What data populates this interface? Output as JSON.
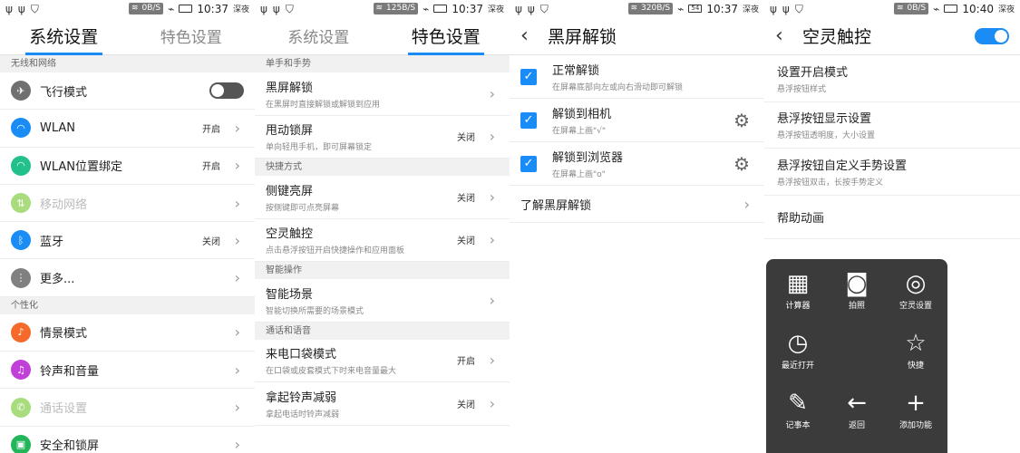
{
  "panels": {
    "p1": {
      "status": {
        "speed": "0B/S",
        "time": "10:37",
        "sub": "深夜"
      },
      "tabs": [
        "系统设置",
        "特色设置"
      ],
      "sections": {
        "wireless": "无线和网络",
        "personal": "个性化"
      },
      "rows": [
        {
          "label": "飞行模式",
          "icon": "airplane-icon",
          "color": "#707070"
        },
        {
          "label": "WLAN",
          "value": "开启",
          "icon": "wifi-icon",
          "color": "#1a8cf5"
        },
        {
          "label": "WLAN位置绑定",
          "value": "开启",
          "icon": "wifi-location-icon",
          "color": "#22c08a"
        },
        {
          "label": "移动网络",
          "icon": "mobile-network-icon",
          "color": "#a8dc7c"
        },
        {
          "label": "蓝牙",
          "value": "关闭",
          "icon": "bluetooth-icon",
          "color": "#1a8cf5"
        },
        {
          "label": "更多...",
          "icon": "more-icon",
          "color": "#808080"
        },
        {
          "label": "情景模式",
          "icon": "bell-icon",
          "color": "#f56a2a"
        },
        {
          "label": "铃声和音量",
          "icon": "music-icon",
          "color": "#c040d8"
        },
        {
          "label": "通话设置",
          "icon": "phone-icon",
          "color": "#a8dc7c"
        },
        {
          "label": "安全和锁屏",
          "icon": "lock-icon",
          "color": "#22b55a"
        }
      ]
    },
    "p2": {
      "status": {
        "speed": "125B/S",
        "time": "10:37",
        "sub": "深夜"
      },
      "tabs": [
        "系统设置",
        "特色设置"
      ],
      "sections": [
        "单手和手势",
        "快捷方式",
        "智能操作",
        "通话和语音"
      ],
      "rows": [
        {
          "title": "黑屏解锁",
          "desc": "在黑屏时直接解锁或解锁到应用"
        },
        {
          "title": "甩动锁屏",
          "desc": "单向轻甩手机，即可屏幕锁定",
          "value": "关闭"
        },
        {
          "title": "侧键亮屏",
          "desc": "按侧键即可点亮屏幕",
          "value": "关闭"
        },
        {
          "title": "空灵触控",
          "desc": "点击悬浮按钮开启快捷操作和应用面板",
          "value": "关闭"
        },
        {
          "title": "智能场景",
          "desc": "智能切换所需要的场景模式"
        },
        {
          "title": "来电口袋模式",
          "desc": "在口袋或皮套模式下时来电音量最大",
          "value": "开启"
        },
        {
          "title": "拿起铃声减弱",
          "desc": "拿起电话时铃声减弱",
          "value": "关闭"
        }
      ]
    },
    "p3": {
      "status": {
        "speed": "320B/S",
        "time": "10:37",
        "sub": "深夜",
        "battery": "54"
      },
      "title": "黑屏解锁",
      "rows": [
        {
          "title": "正常解锁",
          "desc": "在屏幕底部向左或向右滑动即可解锁"
        },
        {
          "title": "解锁到相机",
          "desc": "在屏幕上画\"√\""
        },
        {
          "title": "解锁到浏览器",
          "desc": "在屏幕上画\"o\""
        }
      ],
      "link": "了解黑屏解锁"
    },
    "p4": {
      "status": {
        "speed": "0B/S",
        "time": "10:40",
        "sub": "深夜"
      },
      "title": "空灵触控",
      "rows": [
        {
          "title": "设置开启模式",
          "desc": "悬浮按钮样式"
        },
        {
          "title": "悬浮按钮显示设置",
          "desc": "悬浮按钮透明度，大小设置"
        },
        {
          "title": "悬浮按钮自定义手势设置",
          "desc": "悬浮按钮双击，长按手势定义"
        },
        {
          "title": "帮助动画"
        }
      ],
      "overlay": [
        {
          "label": "计算器",
          "glyph": "▦",
          "icon": "calculator-icon"
        },
        {
          "label": "拍照",
          "glyph": "◙",
          "icon": "camera-icon"
        },
        {
          "label": "空灵设置",
          "glyph": "◎",
          "icon": "touch-settings-icon"
        },
        {
          "label": "最近打开",
          "glyph": "◷",
          "icon": "clock-icon"
        },
        {
          "label": "快捷",
          "glyph": "☆",
          "icon": "star-icon"
        },
        {
          "label": "记事本",
          "glyph": "✎",
          "icon": "notepad-icon"
        },
        {
          "label": "返回",
          "glyph": "←",
          "icon": "back-arrow-icon"
        },
        {
          "label": "添加功能",
          "glyph": "+",
          "icon": "add-icon"
        }
      ]
    }
  },
  "colors": {
    "accent": "#1a8cf5",
    "section_bg": "#f1f1f1"
  }
}
